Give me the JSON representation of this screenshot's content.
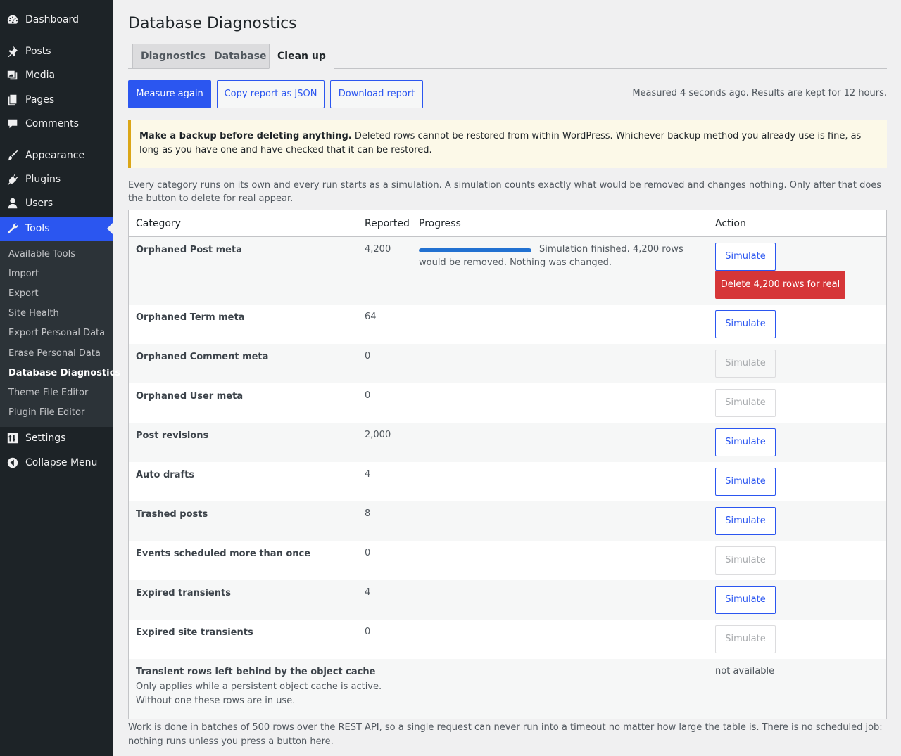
{
  "menu": {
    "dashboard": "Dashboard",
    "posts": "Posts",
    "media": "Media",
    "pages": "Pages",
    "comments": "Comments",
    "appearance": "Appearance",
    "plugins": "Plugins",
    "users": "Users",
    "tools": "Tools",
    "settings": "Settings",
    "collapse": "Collapse Menu",
    "submenu": [
      "Available Tools",
      "Import",
      "Export",
      "Site Health",
      "Export Personal Data",
      "Erase Personal Data",
      "Database Diagnostics",
      "Theme File Editor",
      "Plugin File Editor"
    ]
  },
  "page": {
    "title": "Database Diagnostics",
    "tabs": [
      "Diagnostics",
      "Database",
      "Clean up"
    ],
    "active_tab": "Clean up",
    "buttons": {
      "measure": "Measure again",
      "copy": "Copy report as JSON",
      "download": "Download report"
    },
    "measured": "Measured 4 seconds ago. Results are kept for 12 hours.",
    "notice_bold": "Make a backup before deleting anything.",
    "notice_text": " Deleted rows cannot be restored from within WordPress. Whichever backup method you already use is fine, as long as you have one and have checked that it can be restored.",
    "intro": "Every category runs on its own and every run starts as a simulation. A simulation counts exactly what would be removed and changes nothing. Only after that does the button to delete for real appear.",
    "footer": "Work is done in batches of 500 rows over the REST API, so a single request can never run into a timeout no matter how large the table is. There is no scheduled job: nothing runs unless you press a button here."
  },
  "table": {
    "headers": {
      "category": "Category",
      "reported": "Reported",
      "progress": "Progress",
      "action": "Action"
    },
    "rows": [
      {
        "category": "Orphaned Post meta",
        "reported": "4,200",
        "simulate": "Simulate",
        "progress_text": "Simulation finished. 4,200 rows would be removed. Nothing was changed.",
        "progress": 1.0,
        "delete": "Delete 4,200 rows for real"
      },
      {
        "category": "Orphaned Term meta",
        "reported": "64",
        "simulate": "Simulate"
      },
      {
        "category": "Orphaned Comment meta",
        "reported": "0",
        "simulate": "Simulate"
      },
      {
        "category": "Orphaned User meta",
        "reported": "0",
        "simulate": "Simulate"
      },
      {
        "category": "Post revisions",
        "reported": "2,000",
        "simulate": "Simulate"
      },
      {
        "category": "Auto drafts",
        "reported": "4",
        "simulate": "Simulate"
      },
      {
        "category": "Trashed posts",
        "reported": "8",
        "simulate": "Simulate"
      },
      {
        "category": "Events scheduled more than once",
        "reported": "0",
        "simulate": "Simulate"
      },
      {
        "category": "Expired transients",
        "reported": "4",
        "simulate": "Simulate"
      },
      {
        "category": "Expired site transients",
        "reported": "0",
        "simulate": "Simulate"
      },
      {
        "category": "Transient rows left behind by the object cache",
        "note1": "Only applies while a persistent object cache is active.",
        "note2": "Without one these rows are in use.",
        "action_text": "not available"
      }
    ]
  },
  "colors": {
    "accent": "#2b56f0",
    "danger": "#d63638",
    "sidebar": "#1d2327",
    "warning": "#dba617"
  }
}
